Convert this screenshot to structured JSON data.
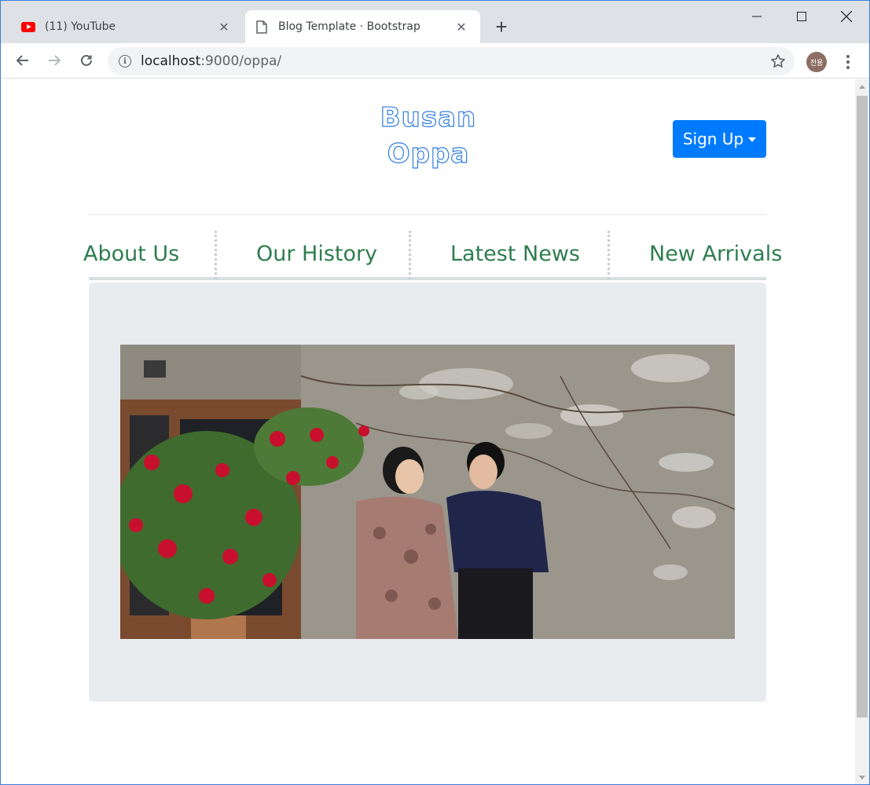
{
  "browser": {
    "tabs": [
      {
        "title": "(11) YouTube",
        "active": false,
        "icon": "youtube-icon"
      },
      {
        "title": "Blog Template · Bootstrap",
        "active": true,
        "icon": "page-icon"
      }
    ],
    "url_host": "localhost",
    "url_rest": ":9000/oppa/",
    "profile_initials": "전용"
  },
  "page": {
    "logo_line1": "Busan",
    "logo_line2": "Oppa",
    "signup_label": "Sign Up",
    "nav": [
      "About Us",
      "Our History",
      "Latest News",
      "New Arrivals"
    ]
  },
  "colors": {
    "primary": "#007bff",
    "nav_text": "#2e7d4f",
    "jumbotron_bg": "#e9ecef"
  }
}
